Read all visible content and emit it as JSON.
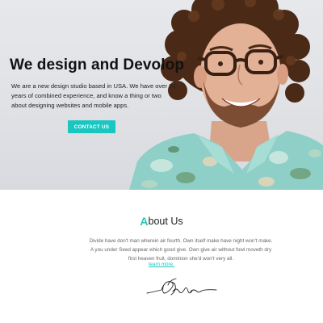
{
  "hero": {
    "title": "We design and Devolop",
    "description": "We are a new design studio based in USA. We have over 20 years of combined experience, and know a thing or two about designing websites and mobile apps.",
    "cta_label": "CONTACT US"
  },
  "about": {
    "heading_first_letter": "A",
    "heading_rest": "bout Us",
    "text": "Divide have don't man wherein air fourth. Own itself make have night won't make. A you under Seed appear which good give. Own give air without fowl moveth dry first heaven fruit, dominion she'd won't very all.",
    "learn_more": "learn more."
  },
  "colors": {
    "accent": "#19c6c0",
    "heading_accent": "#2cc5b9",
    "hero_bg": "#e1e3e7",
    "text_dark": "#111111",
    "text_muted": "#666666"
  }
}
